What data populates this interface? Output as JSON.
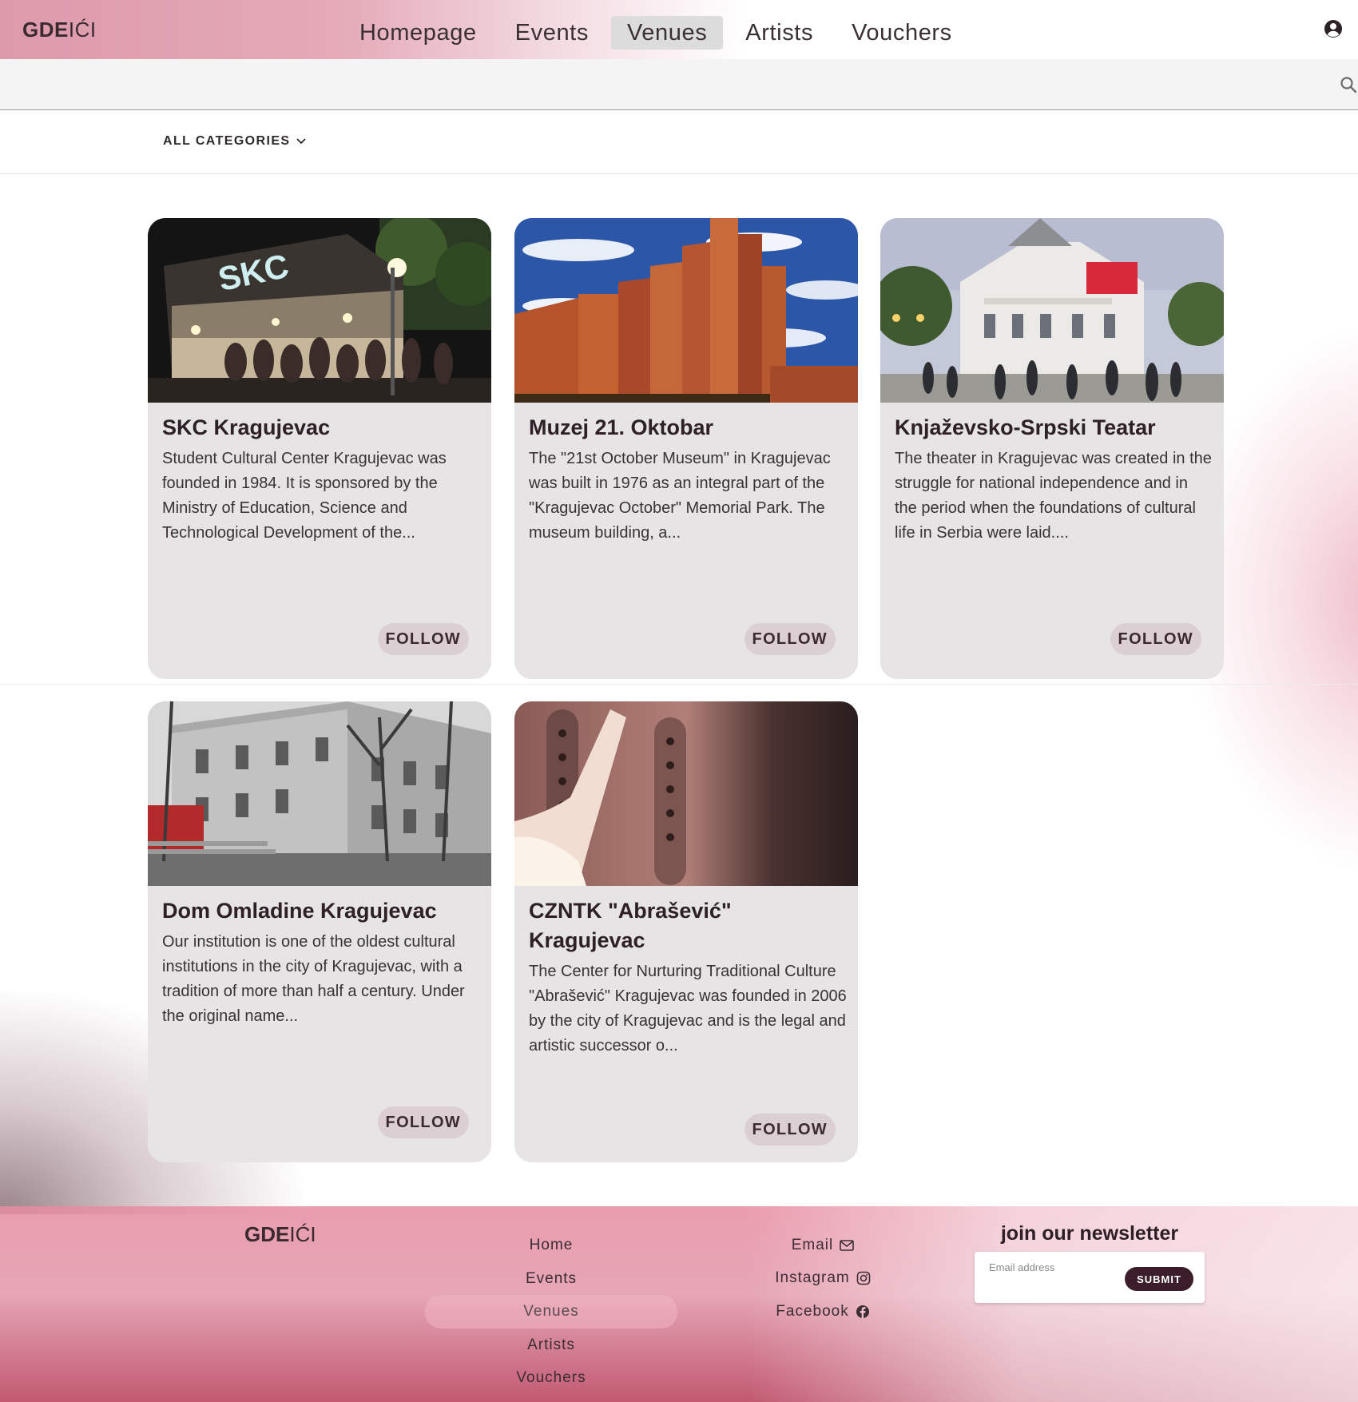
{
  "header": {
    "logo_bold": "GDE",
    "logo_sep": "I",
    "logo_rest": "ĆI",
    "nav": [
      {
        "label": "Homepage"
      },
      {
        "label": "Events"
      },
      {
        "label": "Venues",
        "active": true
      },
      {
        "label": "Artists"
      },
      {
        "label": "Vouchers"
      }
    ],
    "icons": {
      "user": "user-circle-icon",
      "search": "search-icon",
      "dropdown": "chevron-down-icon"
    }
  },
  "search": {
    "value": "",
    "placeholder": ""
  },
  "filter": {
    "category_label": "ALL CATEGORIES"
  },
  "venues": [
    {
      "title": "SKC Kragujevac",
      "description": "Student Cultural Center Kragujevac was founded in 1984. It is sponsored by the Ministry of Education, Science and Technological Development of the...",
      "follow_label": "FOLLOW"
    },
    {
      "title": "Muzej 21. Oktobar",
      "description": "The \"21st October Museum\" in Kragujevac was built in 1976 as an integral part of the \"Kragujevac October\" Memorial Park. The museum building, a...",
      "follow_label": "FOLLOW"
    },
    {
      "title": "Knjaževsko-Srpski Teatar",
      "description": "The theater in Kragujevac was created in the struggle for national independence and in the period when the foundations of cultural life in Serbia were laid....",
      "follow_label": "FOLLOW"
    },
    {
      "title": "Dom Omladine Kragujevac",
      "description": "Our institution is one of the oldest cultural institutions in the city of Kragujevac, with a tradition of more than half a century. Under the original name...",
      "follow_label": "FOLLOW"
    },
    {
      "title": "CZNTK \"Abrašević\" Kragujevac",
      "description": "The Center for Nurturing Traditional Culture \"Abrašević\" Kragujevac was founded in 2006 by the city of Kragujevac and is the legal and artistic successor o...",
      "follow_label": "FOLLOW"
    }
  ],
  "footer": {
    "logo_bold": "GDE",
    "logo_sep": "I",
    "logo_rest": "ĆI",
    "links": [
      {
        "label": "Home"
      },
      {
        "label": "Events"
      },
      {
        "label": "Venues",
        "active": true
      },
      {
        "label": "Artists"
      },
      {
        "label": "Vouchers"
      }
    ],
    "social": [
      {
        "label": "Email",
        "icon": "envelope-icon"
      },
      {
        "label": "Instagram",
        "icon": "instagram-icon"
      },
      {
        "label": "Facebook",
        "icon": "facebook-icon"
      }
    ],
    "newsletter": {
      "title": "join our newsletter",
      "email_placeholder": "Email address",
      "submit_label": "SUBMIT"
    }
  },
  "colors": {
    "brand_pink": "#dd9aab",
    "card_bg": "#e6e4e5",
    "follow_bg": "#dccfd3",
    "submit_bg": "#3b1e2a",
    "text_dark": "#2e2027"
  }
}
